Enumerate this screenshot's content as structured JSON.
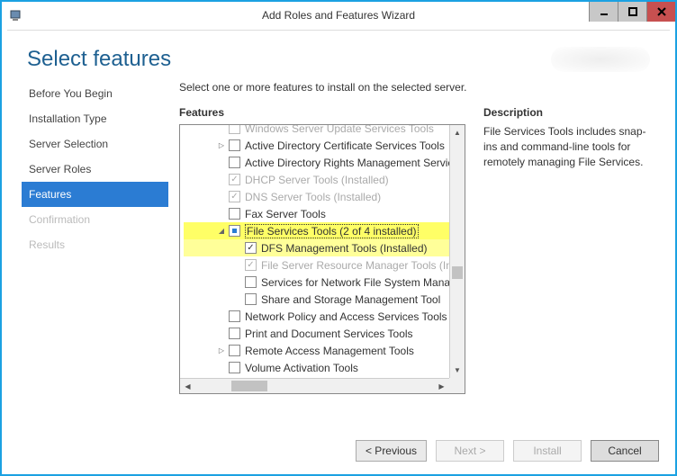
{
  "window": {
    "title": "Add Roles and Features Wizard"
  },
  "header": {
    "title": "Select features"
  },
  "sidebar": {
    "items": [
      {
        "label": "Before You Begin",
        "state": "normal"
      },
      {
        "label": "Installation Type",
        "state": "normal"
      },
      {
        "label": "Server Selection",
        "state": "normal"
      },
      {
        "label": "Server Roles",
        "state": "normal"
      },
      {
        "label": "Features",
        "state": "active"
      },
      {
        "label": "Confirmation",
        "state": "disabled"
      },
      {
        "label": "Results",
        "state": "disabled"
      }
    ]
  },
  "main": {
    "instruction": "Select one or more features to install on the selected server.",
    "features_heading": "Features",
    "description_heading": "Description",
    "description_text": "File Services Tools includes snap-ins and command-line tools for remotely managing File Services.",
    "tree": [
      {
        "depth": 2,
        "expander": "blank",
        "cb": "unchecked",
        "dim": true,
        "label": "Windows Server Update Services Tools",
        "cut": true
      },
      {
        "depth": 2,
        "expander": "right",
        "cb": "unchecked",
        "label": "Active Directory Certificate Services Tools"
      },
      {
        "depth": 2,
        "expander": "blank",
        "cb": "unchecked",
        "label": "Active Directory Rights Management Servic"
      },
      {
        "depth": 2,
        "expander": "blank",
        "cb": "checked",
        "dim": true,
        "label": "DHCP Server Tools (Installed)"
      },
      {
        "depth": 2,
        "expander": "blank",
        "cb": "checked",
        "dim": true,
        "label": "DNS Server Tools (Installed)"
      },
      {
        "depth": 2,
        "expander": "blank",
        "cb": "unchecked",
        "label": "Fax Server Tools"
      },
      {
        "depth": 2,
        "expander": "down",
        "cb": "partial",
        "label": "File Services Tools (2 of 4 installed)",
        "hl": "main"
      },
      {
        "depth": 3,
        "expander": "blank",
        "cb": "checked",
        "label": "DFS Management Tools (Installed)",
        "hl": "sub"
      },
      {
        "depth": 3,
        "expander": "blank",
        "cb": "checked",
        "dim": true,
        "label": "File Server Resource Manager Tools (Ins"
      },
      {
        "depth": 3,
        "expander": "blank",
        "cb": "unchecked",
        "label": "Services for Network File System Manag"
      },
      {
        "depth": 3,
        "expander": "blank",
        "cb": "unchecked",
        "label": "Share and Storage Management Tool"
      },
      {
        "depth": 2,
        "expander": "blank",
        "cb": "unchecked",
        "label": "Network Policy and Access Services Tools"
      },
      {
        "depth": 2,
        "expander": "blank",
        "cb": "unchecked",
        "label": "Print and Document Services Tools"
      },
      {
        "depth": 2,
        "expander": "right",
        "cb": "unchecked",
        "label": "Remote Access Management Tools"
      },
      {
        "depth": 2,
        "expander": "blank",
        "cb": "unchecked",
        "label": "Volume Activation Tools"
      }
    ]
  },
  "footer": {
    "previous": "< Previous",
    "next": "Next >",
    "install": "Install",
    "cancel": "Cancel"
  }
}
